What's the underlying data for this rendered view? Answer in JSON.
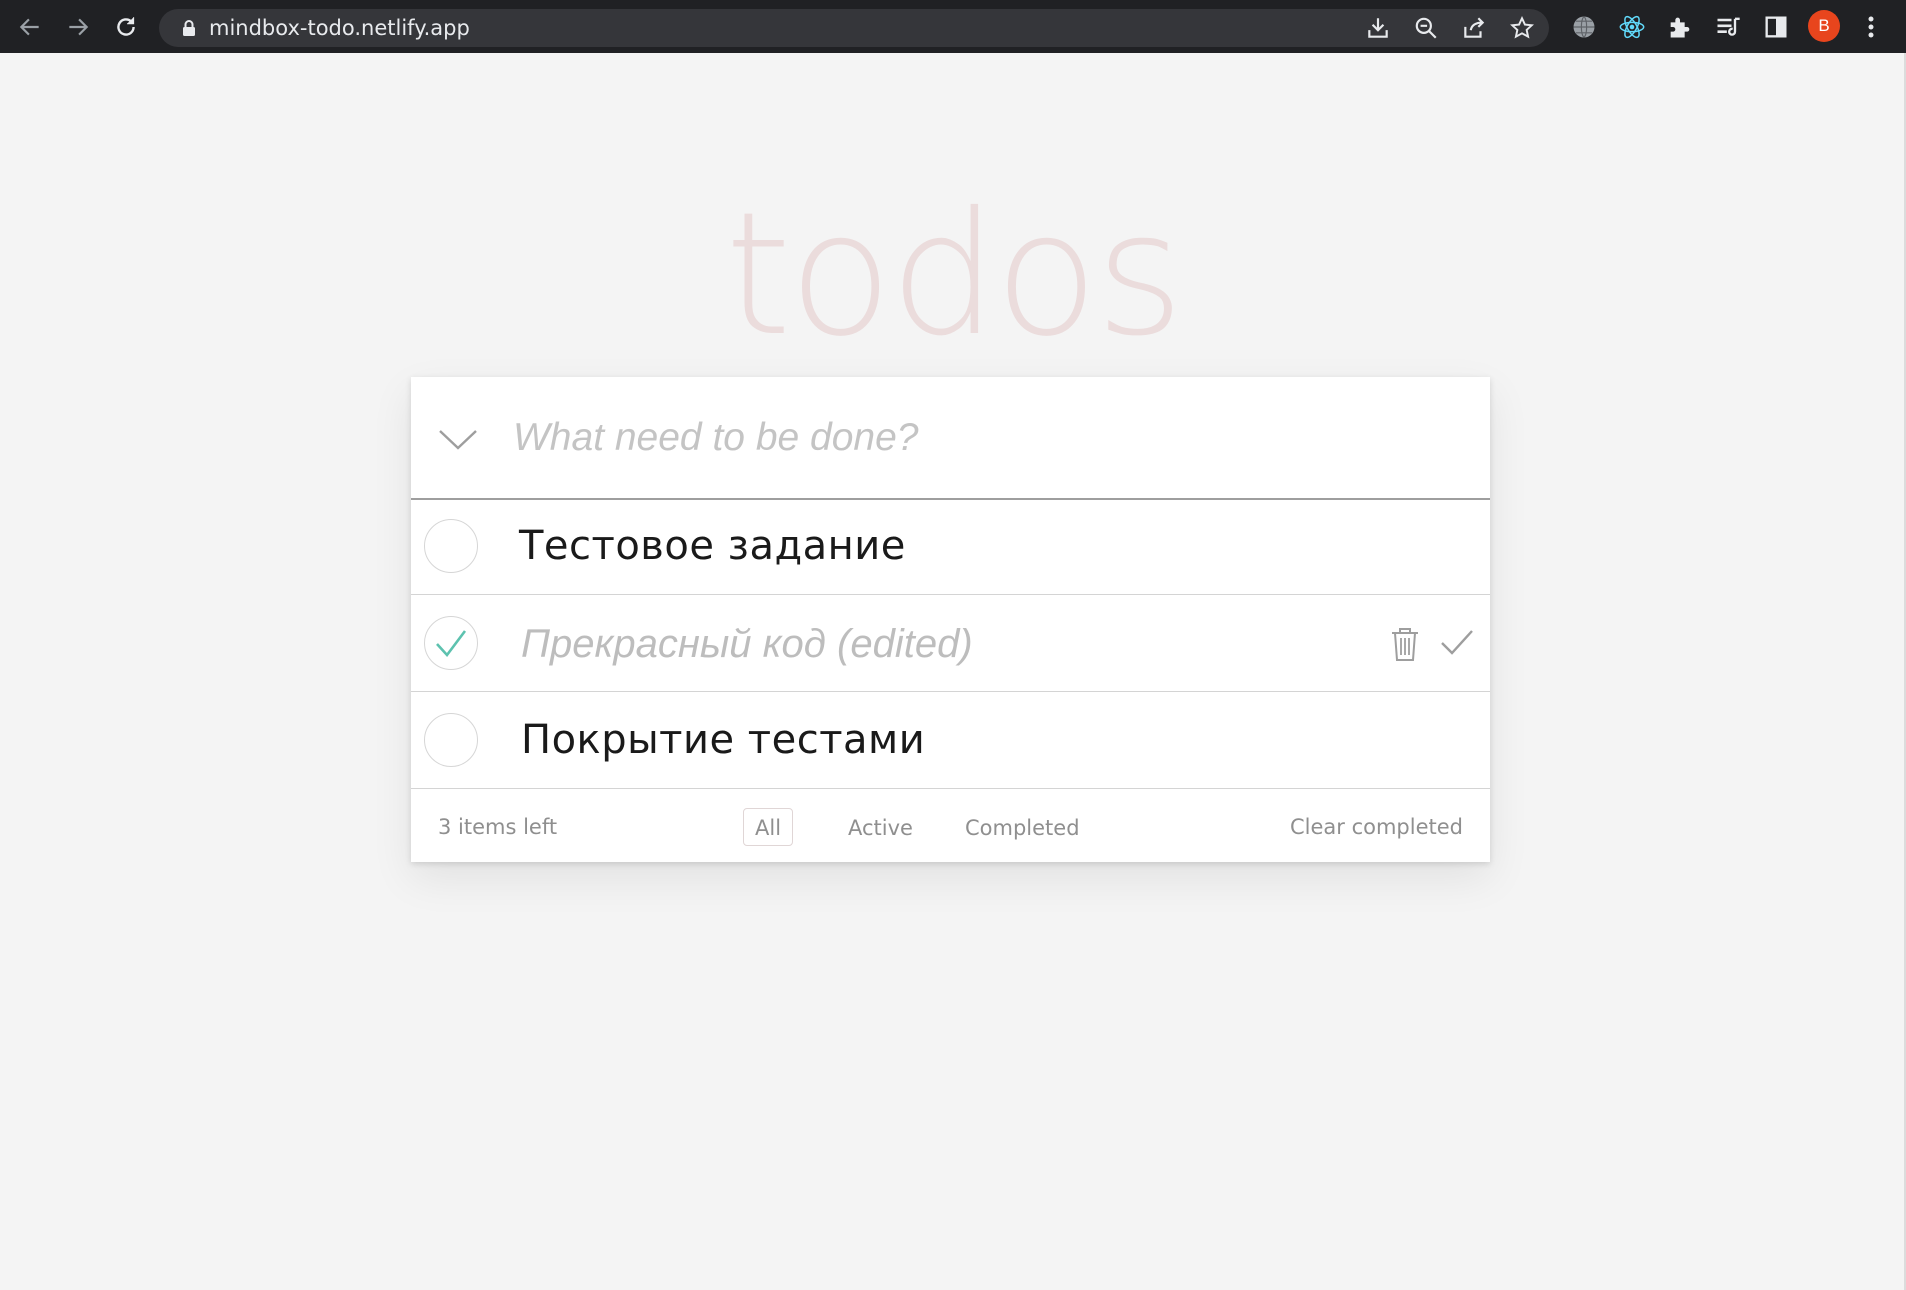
{
  "browser": {
    "url": "mindbox-todo.netlify.app",
    "profile_initial": "B",
    "icons": [
      "back-arrow-icon",
      "forward-arrow-icon",
      "reload-icon",
      "lock-icon",
      "install-icon",
      "zoom-out-icon",
      "share-icon",
      "star-icon",
      "globe-icon",
      "react-icon",
      "puzzle-icon",
      "reading-list-icon",
      "side-panel-icon",
      "more-vert-icon"
    ]
  },
  "app": {
    "title": "todos",
    "new_todo_placeholder": "What need to be done?",
    "todos": [
      {
        "label": "Тестовое задание",
        "completed": false,
        "editing": false
      },
      {
        "label": "Прекрасный код (edited)",
        "completed": true,
        "editing": true
      },
      {
        "label": "Покрытие тестами",
        "completed": false,
        "editing": false
      }
    ],
    "footer": {
      "items_left": "3 items left",
      "filters": [
        "All",
        "Active",
        "Completed"
      ],
      "selected_filter": "All",
      "clear_completed": "Clear completed"
    },
    "colors": {
      "title": "#ebdcdc",
      "check": "#5dc2af",
      "background": "#f4f4f4"
    }
  }
}
